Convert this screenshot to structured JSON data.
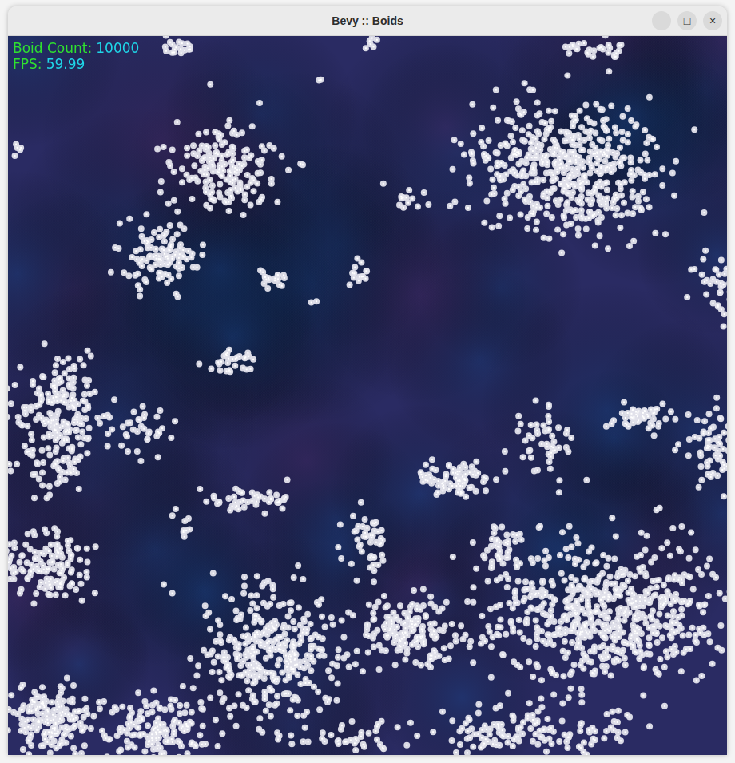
{
  "window": {
    "title": "Bevy :: Boids",
    "controls": [
      "–",
      "□",
      "×"
    ]
  },
  "hud": [
    {
      "label": "Boid Count:",
      "value": "10000"
    },
    {
      "label": "FPS:",
      "value": "59.99"
    }
  ]
}
